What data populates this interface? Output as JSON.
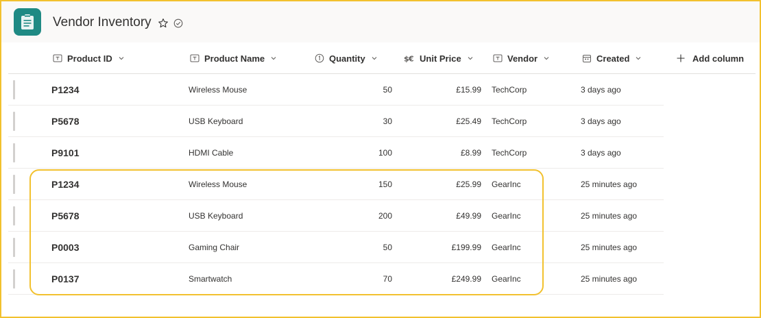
{
  "header": {
    "title": "Vendor Inventory",
    "app_icon": "clipboard-icon",
    "brand_color": "#1f8a84"
  },
  "columns": {
    "product_id": "Product ID",
    "product_name": "Product Name",
    "quantity": "Quantity",
    "unit_price": "Unit Price",
    "vendor": "Vendor",
    "created": "Created",
    "add_column": "Add column"
  },
  "rows": [
    {
      "id": "P1234",
      "name": "Wireless Mouse",
      "qty": "50",
      "price": "£15.99",
      "vendor": "TechCorp",
      "created": "3 days ago"
    },
    {
      "id": "P5678",
      "name": "USB Keyboard",
      "qty": "30",
      "price": "£25.49",
      "vendor": "TechCorp",
      "created": "3 days ago"
    },
    {
      "id": "P9101",
      "name": "HDMI Cable",
      "qty": "100",
      "price": "£8.99",
      "vendor": "TechCorp",
      "created": "3 days ago"
    },
    {
      "id": "P1234",
      "name": "Wireless Mouse",
      "qty": "150",
      "price": "£25.99",
      "vendor": "GearInc",
      "created": "25 minutes ago"
    },
    {
      "id": "P5678",
      "name": "USB Keyboard",
      "qty": "200",
      "price": "£49.99",
      "vendor": "GearInc",
      "created": "25 minutes ago"
    },
    {
      "id": "P0003",
      "name": "Gaming Chair",
      "qty": "50",
      "price": "£199.99",
      "vendor": "GearInc",
      "created": "25 minutes ago"
    },
    {
      "id": "P0137",
      "name": "Smartwatch",
      "qty": "70",
      "price": "£249.99",
      "vendor": "GearInc",
      "created": "25 minutes ago"
    }
  ],
  "colors": {
    "highlight": "#f2c12e"
  }
}
